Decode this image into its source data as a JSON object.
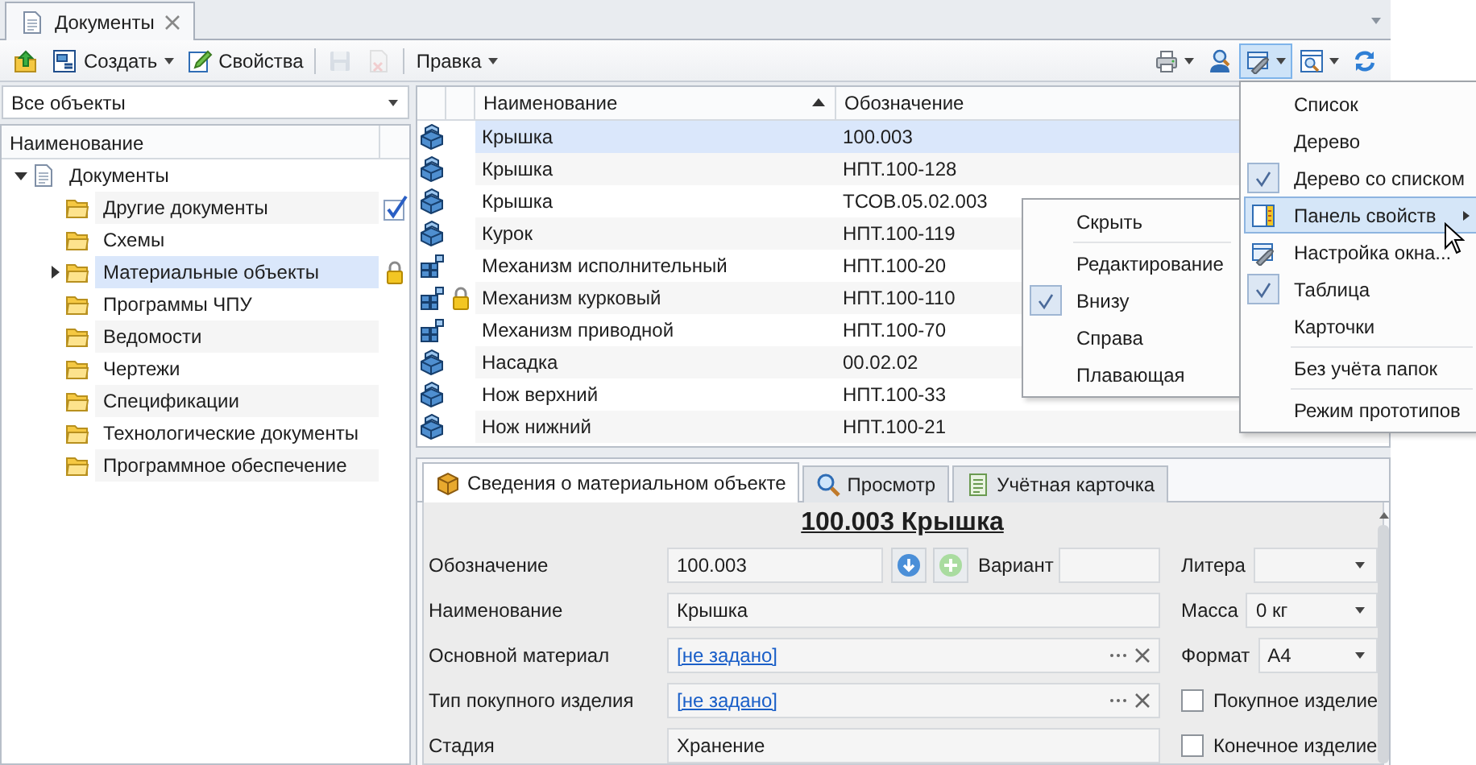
{
  "document_tabs": [
    {
      "label": "Документы",
      "selected": true
    }
  ],
  "toolbar": {
    "left": [
      {
        "kind": "icon",
        "disabled": false,
        "dropdown": false
      },
      {
        "kind": "text",
        "label": "Создать",
        "disabled": false,
        "dropdown": true
      },
      {
        "kind": "text",
        "label": "Свойства",
        "disabled": false,
        "dropdown": false
      },
      {
        "kind": "separator"
      },
      {
        "kind": "icon",
        "disabled": true,
        "dropdown": false
      },
      {
        "kind": "icon",
        "disabled": true,
        "dropdown": false
      },
      {
        "kind": "separator"
      },
      {
        "kind": "text",
        "label": "Правка",
        "disabled": false,
        "dropdown": true
      }
    ],
    "right": [
      {
        "dropdown": true,
        "pressed": false
      },
      {
        "dropdown": false,
        "pressed": false
      },
      {
        "dropdown": true,
        "pressed": true
      },
      {
        "dropdown": true,
        "pressed": false
      },
      {
        "dropdown": false,
        "pressed": false
      }
    ]
  },
  "filter": {
    "value": "Все объекты"
  },
  "tree": {
    "header": "Наименование",
    "items": [
      {
        "kind": "document",
        "label": "Документы",
        "selected": false,
        "expanded": true,
        "children": [
          {
            "kind": "folder",
            "label": "Другие документы",
            "selected": false,
            "checked": true,
            "locked": false
          },
          {
            "kind": "folder",
            "label": "Схемы",
            "selected": false,
            "checked": false,
            "locked": false
          },
          {
            "kind": "folder",
            "label": "Материальные объекты",
            "selected": true,
            "expanded": false,
            "checked": false,
            "locked": true
          },
          {
            "kind": "folder",
            "label": "Программы ЧПУ",
            "selected": false,
            "checked": false,
            "locked": false
          },
          {
            "kind": "folder",
            "label": "Ведомости",
            "selected": false,
            "checked": false,
            "locked": false
          },
          {
            "kind": "folder",
            "label": "Чертежи",
            "selected": false,
            "checked": false,
            "locked": false
          },
          {
            "kind": "folder",
            "label": "Спецификации",
            "selected": false,
            "checked": false,
            "locked": false
          },
          {
            "kind": "folder",
            "label": "Технологические документы",
            "selected": false,
            "checked": false,
            "locked": false
          },
          {
            "kind": "folder",
            "label": "Программное обеспечение",
            "selected": false,
            "checked": false,
            "locked": false
          }
        ]
      }
    ]
  },
  "table": {
    "columns": [
      {
        "label": "Наименование",
        "sorted": true
      },
      {
        "label": "Обозначение"
      }
    ],
    "rows": [
      {
        "kind": "part",
        "locked": false,
        "selected": true,
        "name": "Крышка",
        "designation": "100.003"
      },
      {
        "kind": "part",
        "locked": false,
        "selected": false,
        "name": "Крышка",
        "designation": "НПТ.100-128"
      },
      {
        "kind": "part",
        "locked": false,
        "selected": false,
        "name": "Крышка",
        "designation": "ТСОВ.05.02.003"
      },
      {
        "kind": "part",
        "locked": false,
        "selected": false,
        "name": "Курок",
        "designation": "НПТ.100-119"
      },
      {
        "kind": "assembly",
        "locked": false,
        "selected": false,
        "name": "Механизм исполнительный",
        "designation": "НПТ.100-20"
      },
      {
        "kind": "assembly",
        "locked": true,
        "selected": false,
        "name": "Механизм курковый",
        "designation": "НПТ.100-110"
      },
      {
        "kind": "assembly",
        "locked": false,
        "selected": false,
        "name": "Механизм приводной",
        "designation": "НПТ.100-70"
      },
      {
        "kind": "part",
        "locked": false,
        "selected": false,
        "name": "Насадка",
        "designation": "00.02.02"
      },
      {
        "kind": "part",
        "locked": false,
        "selected": false,
        "name": "Нож верхний",
        "designation": "НПТ.100-33"
      },
      {
        "kind": "part",
        "locked": false,
        "selected": false,
        "name": "Нож нижний",
        "designation": "НПТ.100-21"
      }
    ]
  },
  "properties": {
    "tabs": [
      {
        "kind": "info",
        "label": "Сведения о материальном объекте",
        "selected": true
      },
      {
        "kind": "preview",
        "label": "Просмотр",
        "selected": false
      },
      {
        "kind": "card",
        "label": "Учётная карточка",
        "selected": false
      }
    ],
    "title": "100.003 Крышка",
    "designation": {
      "label": "Обозначение",
      "value": "100.003"
    },
    "variant": {
      "label": "Вариант"
    },
    "litera": {
      "label": "Литера"
    },
    "name": {
      "label": "Наименование",
      "value": "Крышка"
    },
    "mass": {
      "label": "Масса",
      "value": "0 кг"
    },
    "material": {
      "label": "Основной материал",
      "value": "[не задано]"
    },
    "format": {
      "label": "Формат",
      "value": "А4"
    },
    "purchase_type": {
      "label": "Тип покупного изделия",
      "value": "[не задано]"
    },
    "purchased": {
      "label": "Покупное изделие",
      "checked": false
    },
    "stage": {
      "label": "Стадия",
      "value": "Хранение"
    },
    "final": {
      "label": "Конечное изделие",
      "checked": false
    }
  },
  "view_menu": {
    "items": [
      {
        "kind": "option",
        "label": "Список",
        "checked": false,
        "selected": false,
        "separator_before": false
      },
      {
        "kind": "option",
        "label": "Дерево",
        "checked": false,
        "selected": false,
        "separator_before": false
      },
      {
        "kind": "option",
        "label": "Дерево со списком",
        "checked": true,
        "selected": false,
        "separator_before": false
      },
      {
        "kind": "submenu",
        "label": "Панель свойств",
        "checked": false,
        "selected": true,
        "separator_before": false
      },
      {
        "kind": "command",
        "label": "Настройка окна...",
        "checked": false,
        "selected": false,
        "separator_before": false
      },
      {
        "kind": "option",
        "label": "Таблица",
        "checked": true,
        "selected": false,
        "separator_before": false
      },
      {
        "kind": "option",
        "label": "Карточки",
        "checked": false,
        "selected": false,
        "separator_before": false
      },
      {
        "kind": "option",
        "label": "Без учёта папок",
        "checked": false,
        "selected": false,
        "separator_before": true
      },
      {
        "kind": "option",
        "label": "Режим прототипов",
        "checked": false,
        "selected": false,
        "separator_before": true
      }
    ]
  },
  "layout_submenu": {
    "items": [
      {
        "label": "Скрыть",
        "checked": false,
        "selected": false,
        "separator_before": false
      },
      {
        "label": "Редактирование",
        "checked": false,
        "selected": false,
        "separator_before": true
      },
      {
        "label": "Внизу",
        "checked": true,
        "selected": false,
        "separator_before": false
      },
      {
        "label": "Справа",
        "checked": false,
        "selected": false,
        "separator_before": false
      },
      {
        "label": "Плавающая",
        "checked": false,
        "selected": false,
        "separator_before": false
      }
    ]
  }
}
